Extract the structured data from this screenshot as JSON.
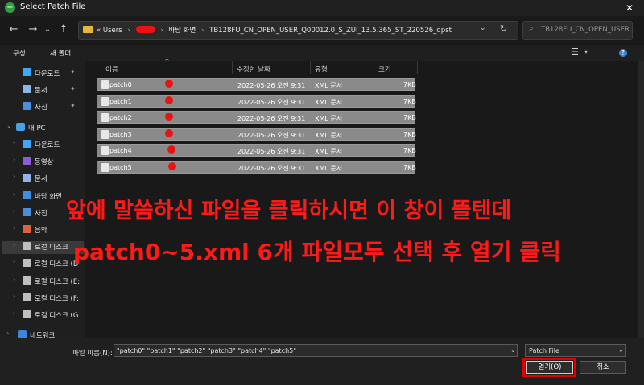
{
  "window": {
    "title": "Select Patch File",
    "close": "✕"
  },
  "nav": {
    "back": "←",
    "forward": "→",
    "dropdown": "⌄",
    "up": "↑"
  },
  "address": {
    "prefix": "«",
    "segments": [
      "Users",
      "바탕 화면",
      "TB128FU_CN_OPEN_USER_Q00012.0_S_ZUI_13.5.365_ST_220526_qpst"
    ],
    "sep": "›",
    "dropdown": "⌄",
    "refresh": "↻"
  },
  "search": {
    "placeholder": "TB128FU_CN_OPEN_USER..."
  },
  "toolbar": {
    "organize": "구성",
    "new_folder": "새 폴더",
    "help": "?"
  },
  "sidebar": {
    "quick": [
      {
        "label": "다운로드",
        "icon": "download-icon",
        "color": "#3fa7ff"
      },
      {
        "label": "문서",
        "icon": "document-icon",
        "color": "#8fb4e8"
      },
      {
        "label": "사진",
        "icon": "picture-icon",
        "color": "#4a90d9"
      }
    ],
    "pc_label": "내 PC",
    "pc_items": [
      {
        "label": "다운로드",
        "icon": "download-icon",
        "color": "#3fa7ff"
      },
      {
        "label": "동영상",
        "icon": "video-icon",
        "color": "#8a5cd6"
      },
      {
        "label": "문서",
        "icon": "document-icon",
        "color": "#8fb4e8"
      },
      {
        "label": "바탕 화면",
        "icon": "desktop-icon",
        "color": "#3f8fe0"
      },
      {
        "label": "사진",
        "icon": "picture-icon",
        "color": "#4a90d9"
      },
      {
        "label": "음악",
        "icon": "music-icon",
        "color": "#e0623a"
      },
      {
        "label": "로컬 디스크",
        "icon": "drive-icon",
        "color": "#bfbfbf"
      },
      {
        "label": "로컬 디스크 (D",
        "icon": "drive-icon",
        "color": "#bfbfbf"
      },
      {
        "label": "로컬 디스크 (E:",
        "icon": "drive-icon",
        "color": "#bfbfbf"
      },
      {
        "label": "로컬 디스크 (F:",
        "icon": "drive-icon",
        "color": "#bfbfbf"
      },
      {
        "label": "로컬 디스크 (G",
        "icon": "drive-icon",
        "color": "#bfbfbf"
      }
    ],
    "network": "네트워크"
  },
  "columns": {
    "name": "이름",
    "modified": "수정한 날짜",
    "type": "유형",
    "size": "크기"
  },
  "files": [
    {
      "name": "patch0",
      "modified": "2022-05-26 오전 9:31",
      "type": "XML 문서",
      "size": "7KB"
    },
    {
      "name": "patch1",
      "modified": "2022-05-26 오전 9:31",
      "type": "XML 문서",
      "size": "7KB"
    },
    {
      "name": "patch2",
      "modified": "2022-05-26 오전 9:31",
      "type": "XML 문서",
      "size": "7KB"
    },
    {
      "name": "patch3",
      "modified": "2022-05-26 오전 9:31",
      "type": "XML 문서",
      "size": "7KB"
    },
    {
      "name": "patch4",
      "modified": "2022-05-26 오전 9:31",
      "type": "XML 문서",
      "size": "7KB"
    },
    {
      "name": "patch5",
      "modified": "2022-05-26 오전 9:31",
      "type": "XML 문서",
      "size": "7KB"
    }
  ],
  "annotation": {
    "line1": "앞에 말씀하신 파일을 클릭하시면 이 창이 뜰텐데",
    "line2": "patch0~5.xml 6개 파일모두 선택 후 열기 클릭",
    "color": "#ff1a1a"
  },
  "filename": {
    "label": "파일 이름(N):",
    "value": "\"patch0\" \"patch1\" \"patch2\" \"patch3\" \"patch4\" \"patch5\"",
    "dropdown": "⌄"
  },
  "filetype": {
    "value": "Patch File",
    "dropdown": "⌄"
  },
  "buttons": {
    "open": "열기(O)",
    "cancel": "취소"
  }
}
